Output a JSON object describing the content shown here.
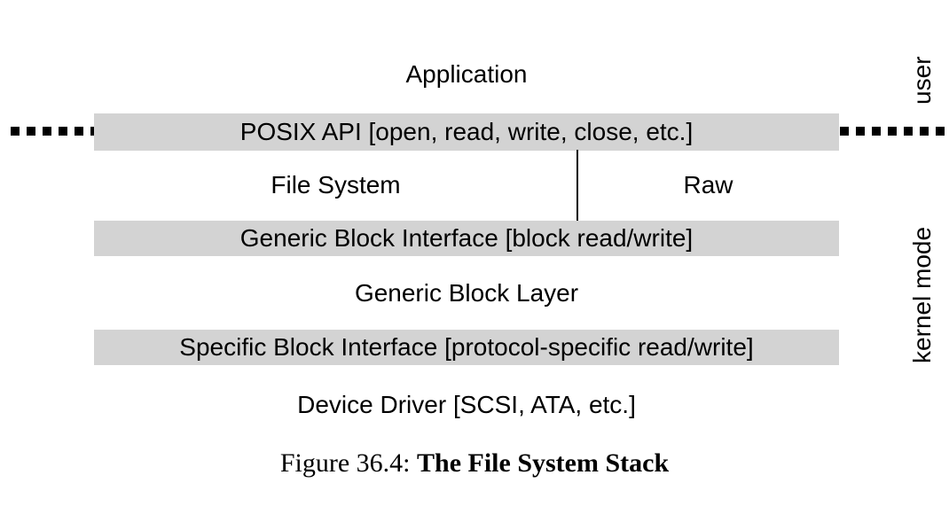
{
  "figure": {
    "caption_prefix": "Figure 36.4: ",
    "caption_title": "The File System Stack",
    "shaded_bar_color": "#d3d3d3",
    "text_color": "#000000",
    "background_color": "#ffffff"
  },
  "side_labels": {
    "user": "user",
    "kernel": "kernel mode"
  },
  "layers": {
    "application": "Application",
    "posix_api": "POSIX API [open, read, write, close, etc.]",
    "file_system": "File System",
    "raw": "Raw",
    "generic_block_interface": "Generic Block Interface [block read/write]",
    "generic_block_layer": "Generic Block Layer",
    "specific_block_interface": "Specific Block Interface [protocol-specific read/write]",
    "device_driver": "Device Driver [SCSI, ATA, etc.]"
  },
  "boundary": {
    "left_dot_count": 6,
    "right_dot_count": 7
  },
  "chart_data": {
    "type": "diagram",
    "title": "The File System Stack",
    "description": "Layered block-diagram of the file system stack; shaded bars are interfaces, plain text rows are implementation layers. A dotted horizontal line at the POSIX API marks the boundary between user space (above) and kernel mode (below).",
    "rows": [
      {
        "label": "Application",
        "style": "plain",
        "region": "user"
      },
      {
        "label": "POSIX API [open, read, write, close, etc.]",
        "style": "shaded",
        "region": "boundary"
      },
      {
        "label": "File System",
        "style": "plain",
        "region": "kernel",
        "column": "left"
      },
      {
        "label": "Raw",
        "style": "plain",
        "region": "kernel",
        "column": "right"
      },
      {
        "label": "Generic Block Interface [block read/write]",
        "style": "shaded",
        "region": "kernel"
      },
      {
        "label": "Generic Block Layer",
        "style": "plain",
        "region": "kernel"
      },
      {
        "label": "Specific Block Interface [protocol-specific read/write]",
        "style": "shaded",
        "region": "kernel"
      },
      {
        "label": "Device Driver [SCSI, ATA, etc.]",
        "style": "plain",
        "region": "kernel"
      }
    ],
    "connectors": [
      {
        "from": "POSIX API [open, read, write, close, etc.]",
        "to": "Generic Block Interface [block read/write]",
        "type": "vertical-line",
        "note": "Raw path bypassing the File System"
      }
    ],
    "regions": [
      "user",
      "kernel mode"
    ]
  }
}
